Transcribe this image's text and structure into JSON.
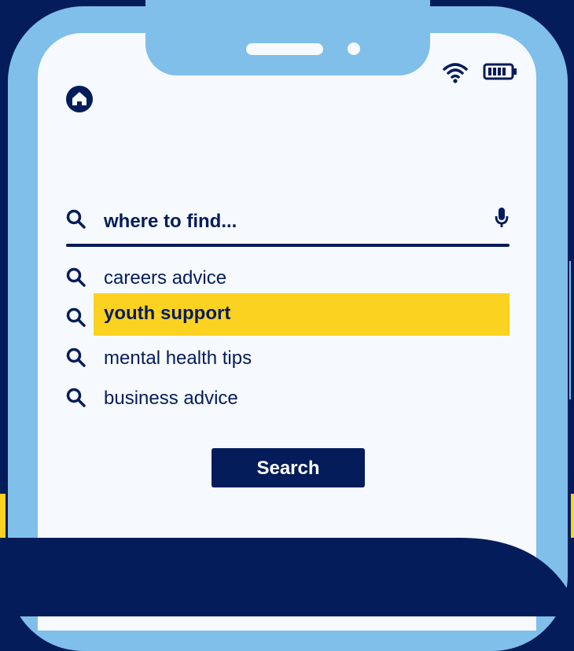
{
  "icons": {
    "home": "home-icon",
    "wifi": "wifi-icon",
    "battery": "battery-icon",
    "search": "search-icon",
    "mic": "microphone-icon"
  },
  "search": {
    "query": "where to find..."
  },
  "suggestions": [
    "careers advice",
    "youth support",
    "mental health tips",
    "business advice"
  ],
  "highlighted_index": 1,
  "button": {
    "label": "Search"
  },
  "colors": {
    "navy": "#041c5a",
    "light_blue": "#7fbfe9",
    "screen": "#f6fafe",
    "yellow": "#fcd220"
  }
}
